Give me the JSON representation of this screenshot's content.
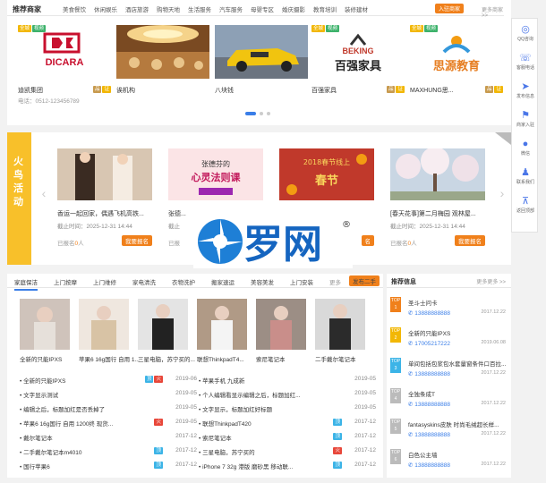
{
  "header": {
    "title": "推荐商家",
    "tabs": [
      "美食餐饮",
      "休闲娱乐",
      "酒店旅游",
      "购物天地",
      "生活服务",
      "汽车服务",
      "母婴专区",
      "婚庆摄影",
      "教育培训",
      "装修建材"
    ],
    "join_label": "入驻商家",
    "more_label": "更多商家 >>"
  },
  "merchants": [
    {
      "name": "迪凯集团",
      "tags": [
        "全城",
        "视频"
      ],
      "right_tags": [
        "品",
        "证"
      ],
      "phone": "电话：0512-123456789"
    },
    {
      "name": "诶机构",
      "tags": [],
      "right_tags": []
    },
    {
      "name": "八块钱",
      "tags": [],
      "right_tags": []
    },
    {
      "name": "百强家具",
      "tags": [
        "全城",
        "视频"
      ],
      "right_tags": [
        "品",
        "证"
      ]
    },
    {
      "name": "MAXHUNG思...",
      "tags": [
        "全城",
        "视频"
      ],
      "right_tags": [
        "品",
        "证"
      ]
    }
  ],
  "sidebar": [
    {
      "icon": "qq-icon",
      "label": "QQ咨询"
    },
    {
      "icon": "phone-icon",
      "label": "客服电话"
    },
    {
      "icon": "send-icon",
      "label": "发布信息"
    },
    {
      "icon": "flag-icon",
      "label": "商家入驻"
    },
    {
      "icon": "wechat-icon",
      "label": "微信"
    },
    {
      "icon": "user-icon",
      "label": "联系我们"
    },
    {
      "icon": "back-top-icon",
      "label": "返回顶部"
    }
  ],
  "activity": {
    "tag": "火鸟活动",
    "items": [
      {
        "title": "香运一起回家，偶遇飞机高铁...",
        "deadline": "截止时间：2025-12-31 14:44",
        "signed_pre": "已报名",
        "count": "0",
        "unit": "人",
        "btn": "我要报名"
      },
      {
        "title": "张德...",
        "deadline": "截止",
        "signed_pre": "已报",
        "count": "",
        "unit": "",
        "btn": "名"
      },
      {
        "title": "",
        "deadline": "",
        "signed_pre": "",
        "count": "",
        "unit": "",
        "btn": "名"
      },
      {
        "title": "[春天花事]第二月梅园 观林屋...",
        "deadline": "截止时间：2025-12-31 14:44",
        "signed_pre": "已报名",
        "count": "0",
        "unit": "人",
        "btn": "我要报名"
      }
    ],
    "poster_texts": {
      "p2_line1": "张德芬的",
      "p2_line2": "心灵法则课",
      "p3_line1": "2018春节线上",
      "p3_line2": "春节"
    }
  },
  "logo": {
    "text": "罗网",
    "reg": "®"
  },
  "goods": {
    "tabs": [
      "家庭保洁",
      "上门按摩",
      "上门维修",
      "家电清洗",
      "衣物洗护",
      "搬家速运",
      "美容美发",
      "上门安装"
    ],
    "more": "更多",
    "post_btn": "发布二手",
    "products": [
      {
        "name": "全新的只能IPXS"
      },
      {
        "name": "苹果6 16g国行 自用 1..."
      },
      {
        "name": "三星电脑，苏宁买的..."
      },
      {
        "name": "联想ThinkpadT4..."
      },
      {
        "name": "索尼笔记本"
      },
      {
        "name": "二手戴尔笔记本"
      }
    ],
    "list_left": [
      {
        "title": "全新的只能IPXS",
        "badges": [
          "blue",
          "red"
        ],
        "date": "2019-06"
      },
      {
        "title": "文字显示测试",
        "badges": [],
        "date": "2019-05"
      },
      {
        "title": "编辑之后，标题加红是否丢掉了",
        "badges": [],
        "date": "2019-05"
      },
      {
        "title": "苹果6 16g国行 自用 1200终 现货...",
        "badges": [
          "red"
        ],
        "date": "2019-05"
      },
      {
        "title": "戴尔笔记本",
        "badges": [],
        "date": "2017-12"
      },
      {
        "title": "二手戴尔笔记本m4010",
        "badges": [
          "blue"
        ],
        "date": "2017-12"
      },
      {
        "title": "国行苹果6",
        "badges": [
          "blue"
        ],
        "date": "2017-12"
      }
    ],
    "list_right": [
      {
        "title": "苹果手机 九成新",
        "badges": [],
        "date": "2019-05"
      },
      {
        "title": "个人编辑看显示编辑之后，标题加红...",
        "badges": [],
        "date": "2019-05"
      },
      {
        "title": "文字显示，标题加红好标题",
        "badges": [],
        "date": "2019-05"
      },
      {
        "title": "联想ThinkpadT420",
        "badges": [
          "blue"
        ],
        "date": "2017-12"
      },
      {
        "title": "索尼笔记本",
        "badges": [
          "blue"
        ],
        "date": "2017-12"
      },
      {
        "title": "三星电脑，苏宁买的",
        "badges": [
          "red"
        ],
        "date": "2017-12"
      },
      {
        "title": "iPhone 7 32g 港版 磨砂黑 移动联...",
        "badges": [
          "blue"
        ],
        "date": "2017-12"
      }
    ]
  },
  "recommend": {
    "title": "推荐信息",
    "more": "更多更多 >>",
    "items": [
      {
        "top": "TOP 1",
        "color": "#f0801b",
        "title": "圣斗士问卡",
        "phone": "13888888888",
        "date": "2017.12.22"
      },
      {
        "top": "TOP 2",
        "color": "#f2b705",
        "title": "全新的只能IPXS",
        "phone": "17005217222",
        "date": "2019.06.08"
      },
      {
        "top": "TOP 3",
        "color": "#3cb4e7",
        "title": "单间包括包浆包水套量窗条件口百拉...",
        "phone": "13888888888",
        "date": "2017.12.22"
      },
      {
        "top": "TOP 4",
        "color": "#bbbbbb",
        "title": "全独条成T",
        "phone": "13888888888",
        "date": "2017.12.22"
      },
      {
        "top": "TOP 5",
        "color": "#bbbbbb",
        "title": "fantasyskins皮肤 时尚毛绒超长样...",
        "phone": "13888888888",
        "date": "2017.12.22"
      },
      {
        "top": "TOP 6",
        "color": "#bbbbbb",
        "title": "白色公主墙",
        "phone": "13888888888",
        "date": "2017.12.22"
      }
    ]
  },
  "colors": {
    "accent": "#3a7ee8",
    "orange": "#f0801b",
    "yellow": "#f8c02a"
  }
}
